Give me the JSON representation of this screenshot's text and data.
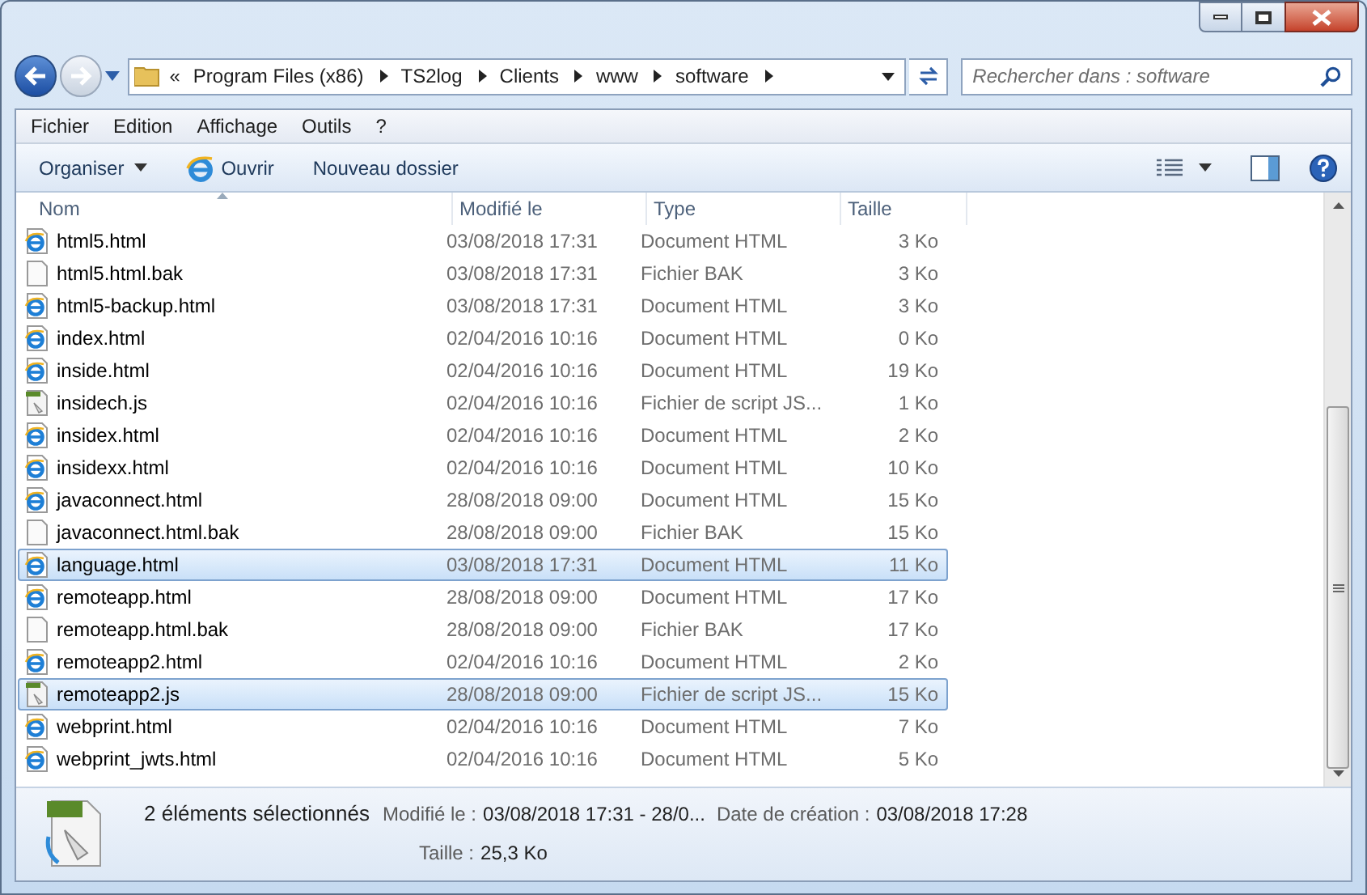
{
  "address_bar": {
    "overflow": "«",
    "crumbs": [
      "Program Files (x86)",
      "TS2log",
      "Clients",
      "www",
      "software"
    ]
  },
  "search": {
    "placeholder": "Rechercher dans : software"
  },
  "menu": [
    "Fichier",
    "Edition",
    "Affichage",
    "Outils",
    "?"
  ],
  "toolbar": {
    "organize": "Organiser",
    "open": "Ouvrir",
    "new_folder": "Nouveau dossier"
  },
  "columns": [
    "Nom",
    "Modifié le",
    "Type",
    "Taille"
  ],
  "files": [
    {
      "kind": "html",
      "name": "html5.html",
      "modified": "03/08/2018 17:31",
      "type": "Document HTML",
      "size": "3 Ko",
      "selected": false
    },
    {
      "kind": "bak",
      "name": "html5.html.bak",
      "modified": "03/08/2018 17:31",
      "type": "Fichier BAK",
      "size": "3 Ko",
      "selected": false
    },
    {
      "kind": "html",
      "name": "html5-backup.html",
      "modified": "03/08/2018 17:31",
      "type": "Document HTML",
      "size": "3 Ko",
      "selected": false
    },
    {
      "kind": "html",
      "name": "index.html",
      "modified": "02/04/2016 10:16",
      "type": "Document HTML",
      "size": "0 Ko",
      "selected": false
    },
    {
      "kind": "html",
      "name": "inside.html",
      "modified": "02/04/2016 10:16",
      "type": "Document HTML",
      "size": "19 Ko",
      "selected": false
    },
    {
      "kind": "js",
      "name": "insidech.js",
      "modified": "02/04/2016 10:16",
      "type": "Fichier de script JS...",
      "size": "1 Ko",
      "selected": false
    },
    {
      "kind": "html",
      "name": "insidex.html",
      "modified": "02/04/2016 10:16",
      "type": "Document HTML",
      "size": "2 Ko",
      "selected": false
    },
    {
      "kind": "html",
      "name": "insidexx.html",
      "modified": "02/04/2016 10:16",
      "type": "Document HTML",
      "size": "10 Ko",
      "selected": false
    },
    {
      "kind": "html",
      "name": "javaconnect.html",
      "modified": "28/08/2018 09:00",
      "type": "Document HTML",
      "size": "15 Ko",
      "selected": false
    },
    {
      "kind": "bak",
      "name": "javaconnect.html.bak",
      "modified": "28/08/2018 09:00",
      "type": "Fichier BAK",
      "size": "15 Ko",
      "selected": false
    },
    {
      "kind": "html",
      "name": "language.html",
      "modified": "03/08/2018 17:31",
      "type": "Document HTML",
      "size": "11 Ko",
      "selected": true
    },
    {
      "kind": "html",
      "name": "remoteapp.html",
      "modified": "28/08/2018 09:00",
      "type": "Document HTML",
      "size": "17 Ko",
      "selected": false
    },
    {
      "kind": "bak",
      "name": "remoteapp.html.bak",
      "modified": "28/08/2018 09:00",
      "type": "Fichier BAK",
      "size": "17 Ko",
      "selected": false
    },
    {
      "kind": "html",
      "name": "remoteapp2.html",
      "modified": "02/04/2016 10:16",
      "type": "Document HTML",
      "size": "2 Ko",
      "selected": false
    },
    {
      "kind": "js",
      "name": "remoteapp2.js",
      "modified": "28/08/2018 09:00",
      "type": "Fichier de script JS...",
      "size": "15 Ko",
      "selected": true
    },
    {
      "kind": "html",
      "name": "webprint.html",
      "modified": "02/04/2016 10:16",
      "type": "Document HTML",
      "size": "7 Ko",
      "selected": false
    },
    {
      "kind": "html",
      "name": "webprint_jwts.html",
      "modified": "02/04/2016 10:16",
      "type": "Document HTML",
      "size": "5 Ko",
      "selected": false
    }
  ],
  "details": {
    "count": "2 éléments sélectionnés",
    "fields": [
      {
        "label": "Modifié le :",
        "value": "03/08/2018 17:31 - 28/0..."
      },
      {
        "label": "Date de création :",
        "value": "03/08/2018 17:28"
      },
      {
        "label": "Taille :",
        "value": "25,3 Ko"
      }
    ]
  }
}
